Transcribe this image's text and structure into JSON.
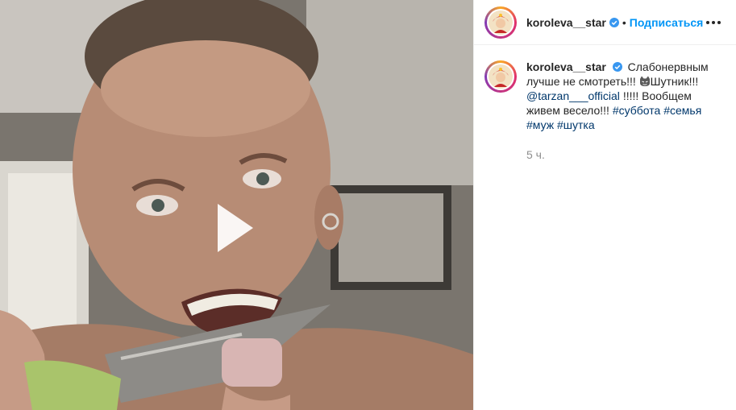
{
  "post": {
    "username": "koroleva__star",
    "separator": "•",
    "follow_label": "Подписаться"
  },
  "caption": {
    "username": "koroleva__star",
    "text_part1": "Слабонервным лучше не смотреть!!!",
    "emoji": "cat-face-emoji",
    "text_part2": "Шутник!!!",
    "mention": "@tarzan___official",
    "text_part3": "!!!!! Вообщем живем весело!!!",
    "hashtags": [
      "#суббота",
      "#семья",
      "#муж",
      "#шутка"
    ],
    "time": "5 ч."
  },
  "media": {
    "type": "video",
    "play_icon": "play-icon"
  },
  "colors": {
    "link_blue": "#0095f6",
    "mention_blue": "#00376b",
    "verified_blue": "#3897f0",
    "muted": "#8e8e8e"
  }
}
